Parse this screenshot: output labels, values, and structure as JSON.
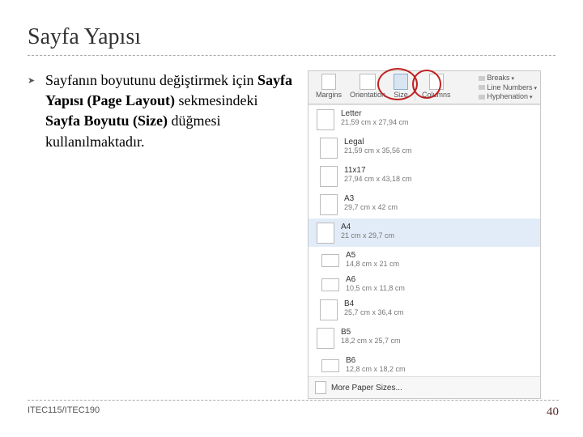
{
  "title": "Sayfa Yapısı",
  "bullet": {
    "pre": "Sayfanın boyutunu değiştirmek için ",
    "b1": "Sayfa Yapısı (Page Layout)",
    "mid": " sekmesindeki ",
    "b2": "Sayfa Boyutu (Size)",
    "post": " düğmesi kullanılmaktadır."
  },
  "ribbon": {
    "margins": "Margins",
    "orientation": "Orientation",
    "size": "Size",
    "columns": "Columns",
    "breaks": "Breaks",
    "lineNumbers": "Line Numbers",
    "hyphenation": "Hyphenation"
  },
  "sizes": [
    {
      "name": "Letter",
      "dims": "21,59 cm x 27,94 cm",
      "thumb": ""
    },
    {
      "name": "Legal",
      "dims": "21,59 cm x 35,56 cm",
      "thumb": "t"
    },
    {
      "name": "11x17",
      "dims": "27,94 cm x 43,18 cm",
      "thumb": "t"
    },
    {
      "name": "A3",
      "dims": "29,7 cm x 42 cm",
      "thumb": "t"
    },
    {
      "name": "A4",
      "dims": "21 cm x 29,7 cm",
      "thumb": "",
      "sel": true
    },
    {
      "name": "A5",
      "dims": "14,8 cm x 21 cm",
      "thumb": "a5"
    },
    {
      "name": "A6",
      "dims": "10,5 cm x 11,8 cm",
      "thumb": "a5"
    },
    {
      "name": "B4",
      "dims": "25,7 cm x 36,4 cm",
      "thumb": "t"
    },
    {
      "name": "B5",
      "dims": "18,2 cm x 25,7 cm",
      "thumb": ""
    },
    {
      "name": "B6",
      "dims": "12,8 cm x 18,2 cm",
      "thumb": "a5"
    }
  ],
  "more": "More Paper Sizes...",
  "footer": {
    "course": "ITEC115/ITEC190",
    "page": "40"
  }
}
